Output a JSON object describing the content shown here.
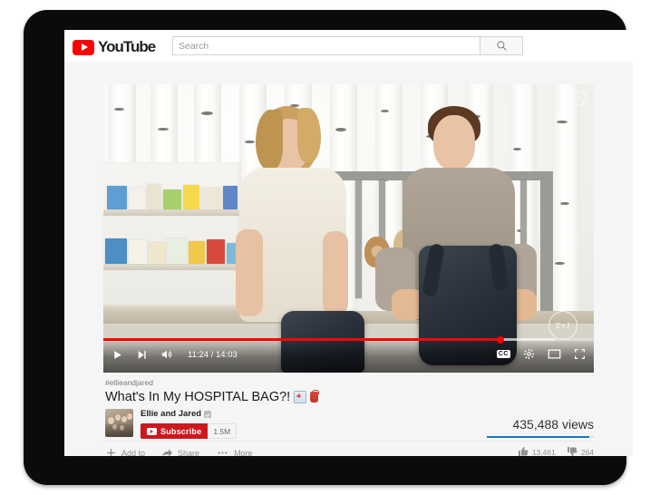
{
  "brand": {
    "name": "YouTube",
    "logo_color": "#ff0000",
    "play_icon": "play-triangle-icon"
  },
  "search": {
    "placeholder": "Search",
    "value": "",
    "button_icon": "search-icon"
  },
  "player": {
    "current_time": "11:24",
    "duration": "14:03",
    "time_display": "11:24 / 14:03",
    "progress_percent": 81,
    "loaded_percent": 92,
    "progress_color": "#ff0000",
    "controls": {
      "play_label": "play-icon",
      "next_label": "next-icon",
      "volume_label": "volume-icon",
      "captions_label": "CC",
      "settings_label": "gear-icon",
      "theater_label": "theater-mode-icon",
      "fullscreen_label": "fullscreen-icon"
    },
    "info_button": "i",
    "watermark": "E+J"
  },
  "video": {
    "hashtag": "#ellieandjared",
    "title": "What's In My HOSPITAL BAG?!",
    "emoji_1": "hospital-emoji",
    "emoji_2": "handbag-emoji",
    "view_count": "435,488 views",
    "likes": "13,461",
    "dislikes": "264"
  },
  "channel": {
    "name": "Ellie and Jared",
    "verified": "verified-badge",
    "subscribe_label": "Subscribe",
    "subscriber_count": "1.5M",
    "subscribe_color": "#cc181e"
  },
  "actions": [
    {
      "label": "Add to",
      "icon": "plus-icon"
    },
    {
      "label": "Share",
      "icon": "share-arrow-icon"
    },
    {
      "label": "More",
      "icon": "ellipsis-icon"
    }
  ]
}
